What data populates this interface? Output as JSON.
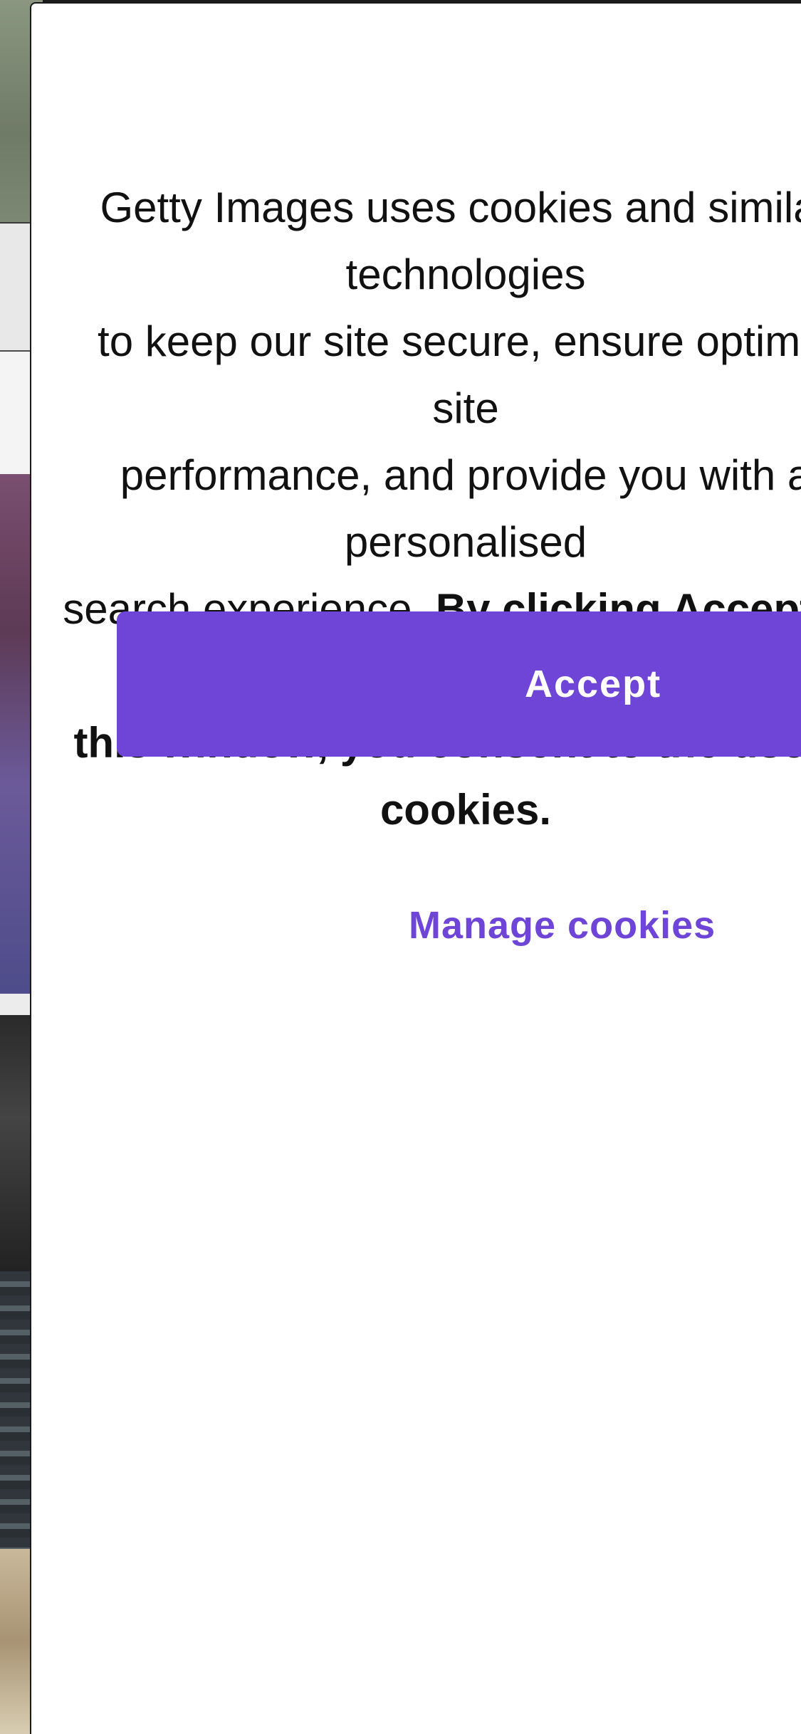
{
  "cookie_dialog": {
    "message_line1": "Getty Images uses cookies and similar technologies",
    "message_line2": "to keep our site secure, ensure optimal site",
    "message_line3": "performance, and provide you with a personalised",
    "message_line4_plain": "search experience. ",
    "message_line4_bold": "By clicking Accept or closing",
    "message_line5_bold": "this window, you consent to the use of cookies.",
    "accept_label": "Accept",
    "manage_label": "Manage cookies"
  },
  "colors": {
    "accent": "#6e45d6",
    "text": "#111111",
    "dialog_bg": "#ffffff"
  }
}
